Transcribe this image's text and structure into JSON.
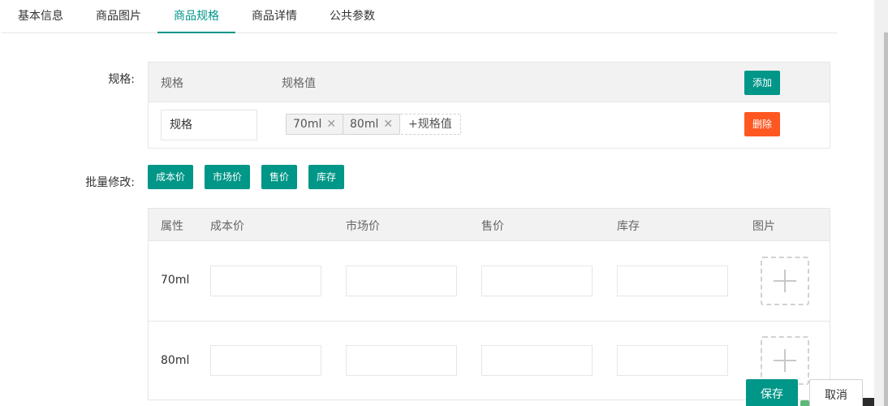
{
  "tabs": [
    {
      "label": "基本信息",
      "active": false
    },
    {
      "label": "商品图片",
      "active": false
    },
    {
      "label": "商品规格",
      "active": true
    },
    {
      "label": "商品详情",
      "active": false
    },
    {
      "label": "公共参数",
      "active": false
    }
  ],
  "spec": {
    "label": "规格:",
    "col_spec": "规格",
    "col_values": "规格值",
    "add_button": "添加",
    "row": {
      "name_value": "规格",
      "values": [
        "70ml",
        "80ml"
      ],
      "add_value_label": "+规格值",
      "delete_button": "删除"
    }
  },
  "batch": {
    "label": "批量修改:",
    "buttons": [
      "成本价",
      "市场价",
      "售价",
      "库存"
    ]
  },
  "sku_table": {
    "headers": [
      "属性",
      "成本价",
      "市场价",
      "售价",
      "库存",
      "图片"
    ],
    "rows": [
      {
        "attr": "70ml"
      },
      {
        "attr": "80ml"
      }
    ]
  },
  "footer": {
    "save": "保存",
    "cancel": "取消"
  },
  "colors": {
    "primary": "#009688",
    "danger": "#ff5722"
  }
}
